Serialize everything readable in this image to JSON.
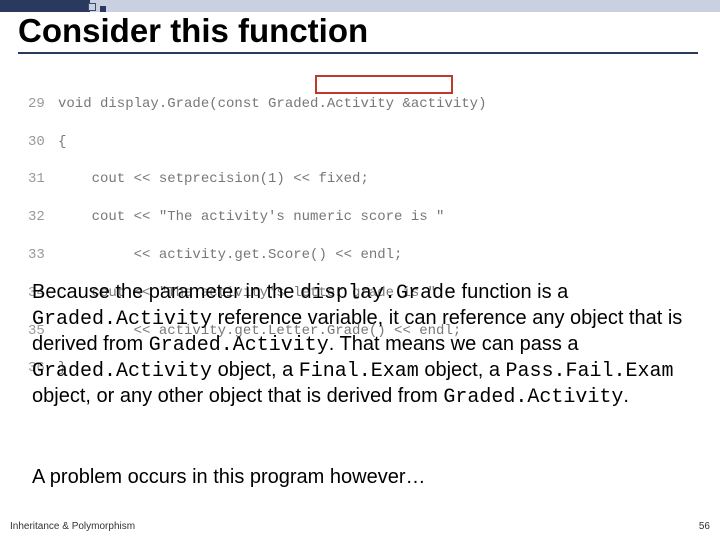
{
  "title": "Consider this function",
  "code": {
    "line29": {
      "n": "29",
      "t": "void display.Grade(const Graded.Activity &activity)"
    },
    "line30": {
      "n": "30",
      "t": "{"
    },
    "line31": {
      "n": "31",
      "t": "    cout << setprecision(1) << fixed;"
    },
    "line32": {
      "n": "32",
      "t": "    cout << \"The activity's numeric score is \""
    },
    "line33": {
      "n": "33",
      "t": "         << activity.get.Score() << endl;"
    },
    "line34": {
      "n": "34",
      "t": "    cout << \"The activity's letter grade is \""
    },
    "line35": {
      "n": "35",
      "t": "         << activity.get.Letter.Grade() << endl;"
    },
    "line36": {
      "n": "36",
      "t": "}"
    }
  },
  "para1": {
    "t1": "Because the parameter in the ",
    "c1": "display.Grade",
    "t2": " function is a ",
    "c2": "Graded.Activity",
    "t3": " reference variable, it can reference any object that is derived from ",
    "c3": "Graded.Activity",
    "t4": ". That means we can pass a ",
    "c4": "Graded.Activity",
    "t5": " object, a ",
    "c5": "Final.Exam",
    "t6": " object, a ",
    "c6": "Pass.Fail.Exam",
    "t7": " object, or any other object that is derived from ",
    "c7": "Graded.Activity",
    "t8": "."
  },
  "para2": "A problem occurs in this program however…",
  "footer": {
    "left": "Inheritance & Polymorphism",
    "right": "56"
  }
}
